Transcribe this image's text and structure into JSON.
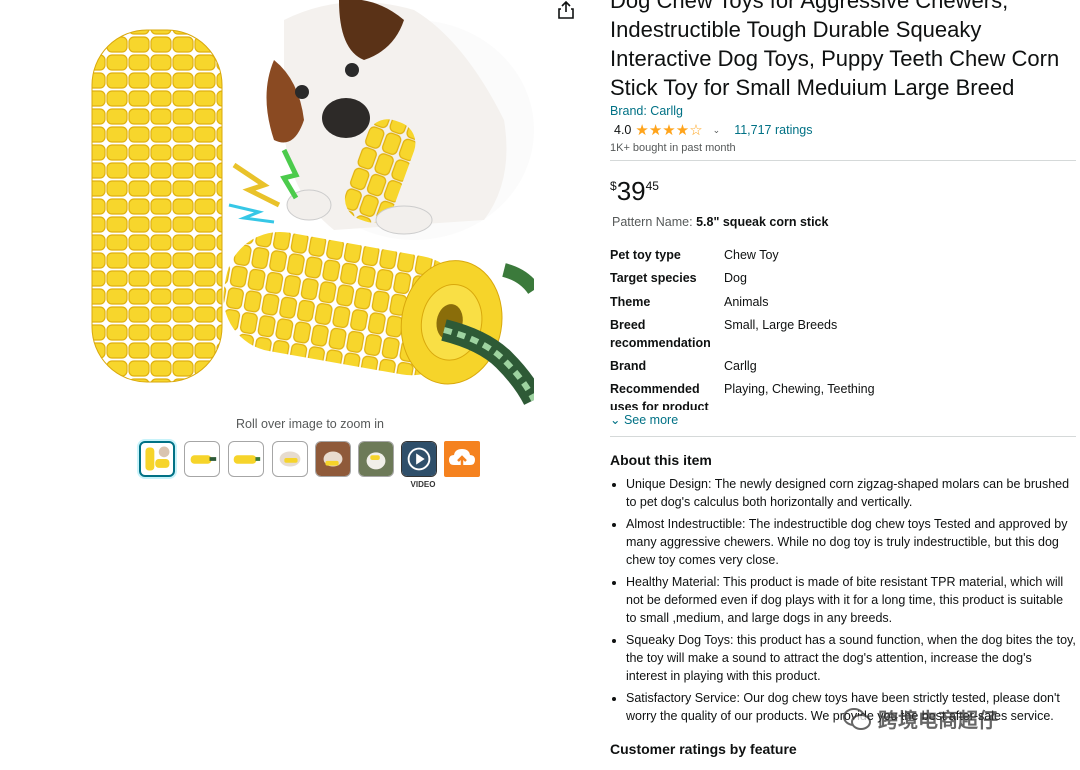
{
  "product": {
    "title": "Dog Chew Toys for Aggressive Chewers, Indestructible Tough Durable Squeaky Interactive Dog Toys, Puppy Teeth Chew Corn Stick Toy for Small Meduium Large Breed",
    "brand_link": "Brand: Carllg",
    "rating_value": "4.0",
    "rating_stars": 4,
    "ratings_count": "11,717 ratings",
    "bought_text": "1K+ bought in past month",
    "price_symbol": "$",
    "price_whole": "39",
    "price_fraction": "45",
    "pattern_label": "Pattern Name:",
    "pattern_value": "5.8\" squeak corn stick"
  },
  "gallery": {
    "zoom_hint": "Roll over image to zoom in",
    "video_label": "VIDEO",
    "thumbnail_count": 8
  },
  "specs": [
    {
      "key": "Pet toy type",
      "value": "Chew Toy"
    },
    {
      "key": "Target species",
      "value": "Dog"
    },
    {
      "key": "Theme",
      "value": "Animals"
    },
    {
      "key": "Breed recommendation",
      "value": "Small, Large Breeds"
    },
    {
      "key": "Brand",
      "value": "Carllg"
    },
    {
      "key": "Recommended uses for product",
      "value": "Playing, Chewing, Teething"
    }
  ],
  "see_more": "See more",
  "about": {
    "heading": "About this item",
    "bullets": [
      "Unique Design: The newly designed corn zigzag-shaped molars can be brushed to pet dog's calculus both horizontally and vertically.",
      "Almost Indestructible: The indestructible dog chew toys Tested and approved by many aggressive chewers. While no dog toy is truly indestructible, but this dog chew toy comes very close.",
      "Healthy Material: This product is made of bite resistant TPR material, which will not be deformed even if dog plays with it for a long time, this product is suitable to small ,medium, and large dogs in any breeds.",
      "Squeaky Dog Toys: this product has a sound function, when the dog bites the toy, the toy will make a sound to attract the dog's attention, increase the dog's interest in playing with this product.",
      "Satisfactory Service: Our dog chew toys have been strictly tested, please don't worry the quality of our products. We provide you the best after-sales service."
    ]
  },
  "customer_ratings_heading": "Customer ratings by feature",
  "watermark_text": "跨境电商超仔",
  "colors": {
    "link": "#007185",
    "star": "#FFA41C",
    "corn": "#F6D42A",
    "upload_orange": "#F5821F"
  }
}
